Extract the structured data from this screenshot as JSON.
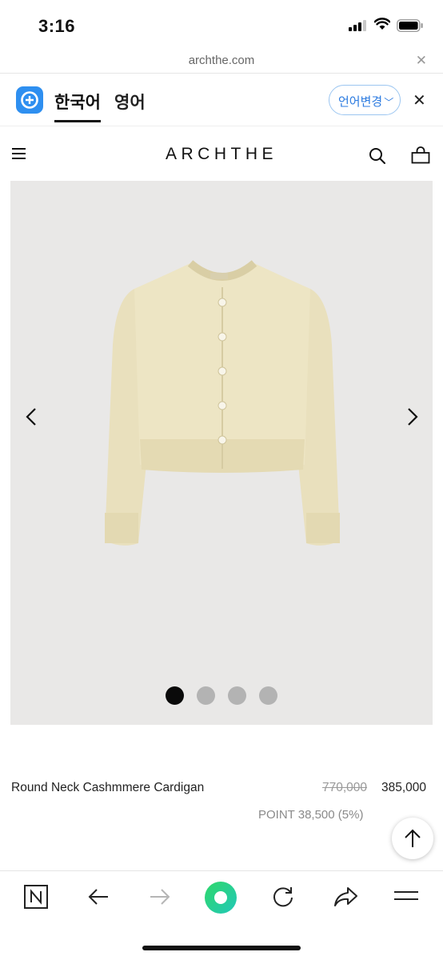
{
  "status_bar": {
    "time": "3:16"
  },
  "browser": {
    "url": "archthe.com"
  },
  "translate_bar": {
    "tab_active": "한국어",
    "tab_inactive": "영어",
    "change_language": "언어변경"
  },
  "site": {
    "brand": "ARCHTHE"
  },
  "gallery": {
    "slide_count": 4,
    "active_index": 0
  },
  "product": {
    "name": "Round Neck Cashmmere Cardigan",
    "original_price": "770,000",
    "sale_price": "385,000",
    "points": "POINT 38,500 (5%)"
  },
  "colors": {
    "accent": "#2e8ff0",
    "active_dot": "#0a0a0a",
    "inactive_dot": "#b3b3b3",
    "garment": "#ece4c2"
  },
  "icons": [
    "signal-icon",
    "wifi-icon",
    "battery-icon",
    "close-icon",
    "translate-logo-icon",
    "chevron-down-icon",
    "menu-icon",
    "search-icon",
    "bag-icon",
    "chevron-left-icon",
    "chevron-right-icon",
    "arrow-up-icon",
    "naver-n-icon",
    "arrow-left-icon",
    "arrow-right-icon",
    "green-dot-icon",
    "refresh-icon",
    "share-icon",
    "hamburger-icon"
  ]
}
